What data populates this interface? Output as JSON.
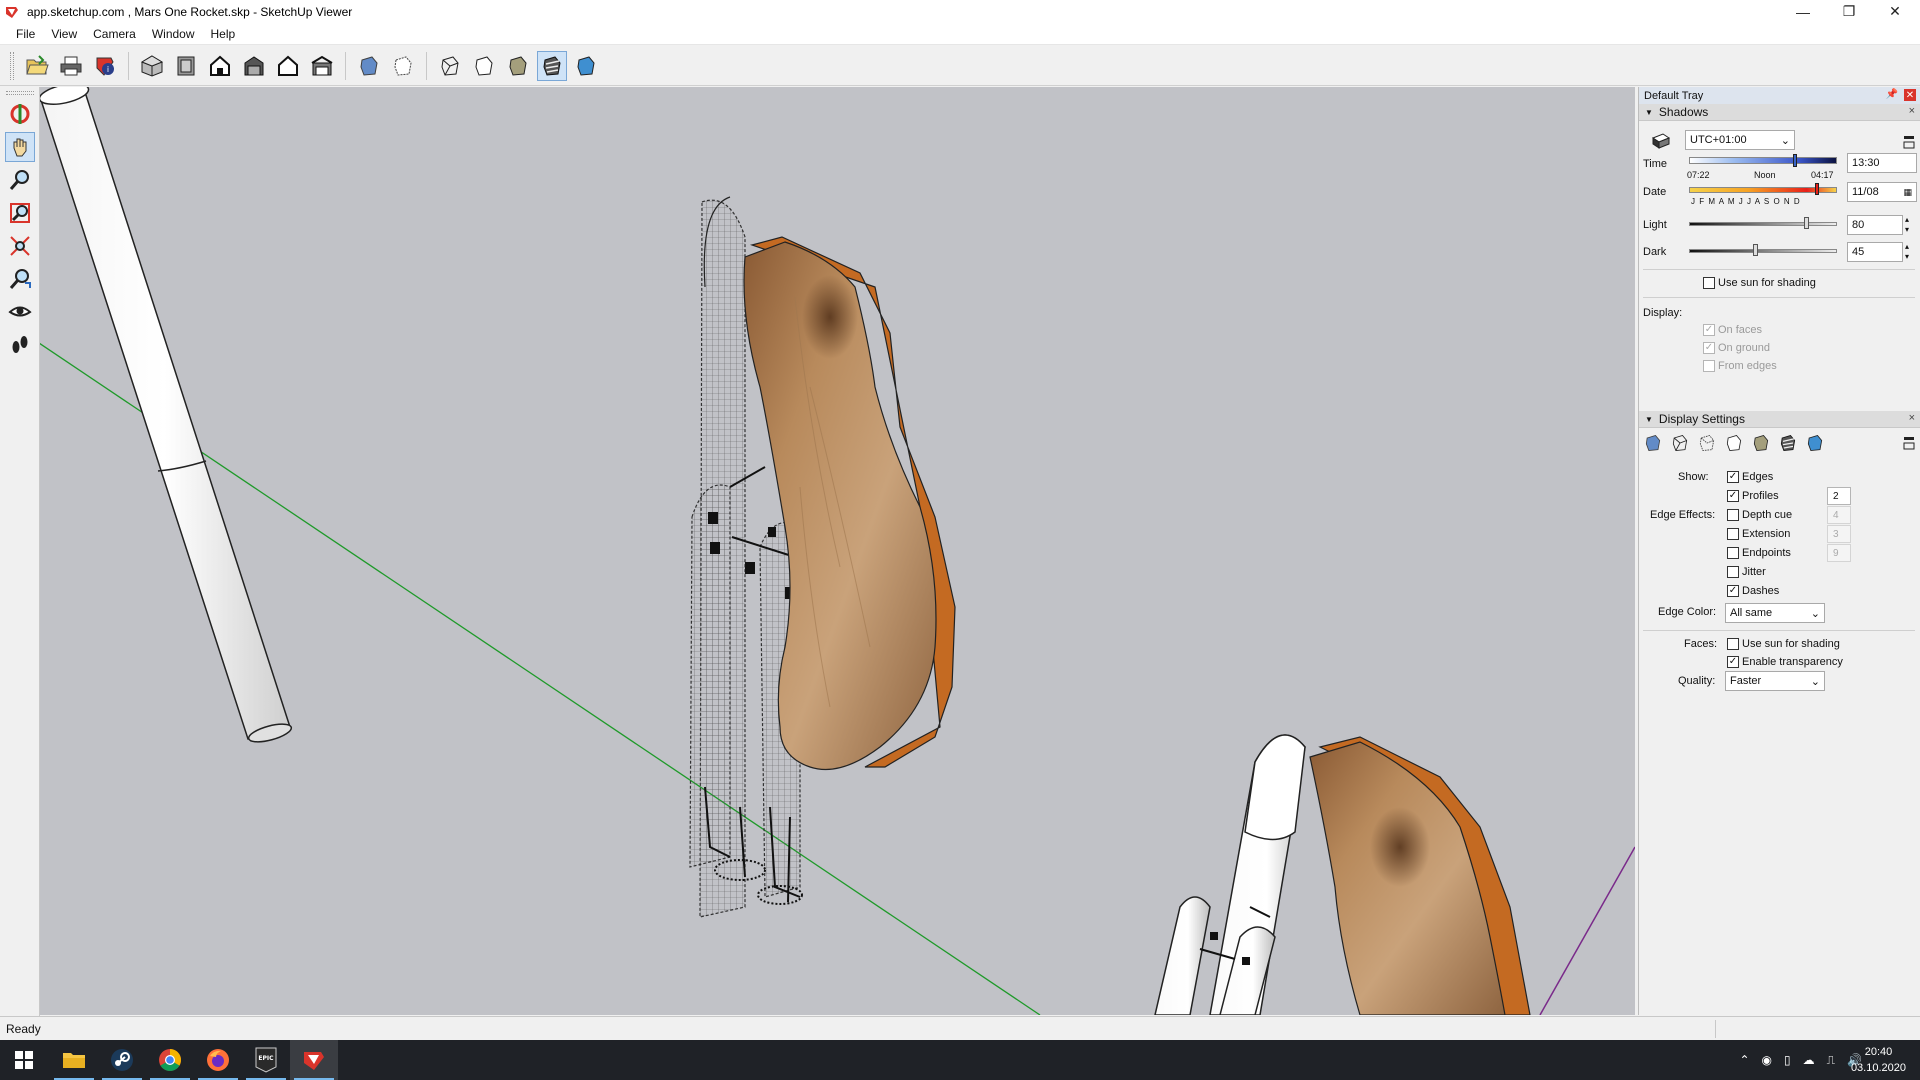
{
  "window": {
    "title": "app.sketchup.com , Mars One Rocket.skp - SketchUp Viewer",
    "minimize": "—",
    "maximize": "❐",
    "close": "✕"
  },
  "menu": [
    "File",
    "View",
    "Camera",
    "Window",
    "Help"
  ],
  "tray": {
    "title": "Default Tray",
    "shadows": {
      "header": "Shadows",
      "timezone": "UTC+01:00",
      "time_label": "Time",
      "time_start": "07:22",
      "time_noon": "Noon",
      "time_end": "04:17",
      "time_value": "13:30",
      "time_position": 0.72,
      "date_label": "Date",
      "months": "J F M A M J J A S O N D",
      "date_value": "11/08",
      "date_position": 0.88,
      "light_label": "Light",
      "light_value": "80",
      "dark_label": "Dark",
      "dark_value": "45",
      "use_sun": "Use sun for shading",
      "display_label": "Display:",
      "on_faces": "On faces",
      "on_ground": "On ground",
      "from_edges": "From edges"
    },
    "display_settings": {
      "header": "Display Settings",
      "show_label": "Show:",
      "edges": "Edges",
      "profiles": "Profiles",
      "profiles_value": "2",
      "edge_effects_label": "Edge Effects:",
      "depth_cue": "Depth cue",
      "depth_cue_value": "4",
      "extension": "Extension",
      "extension_value": "3",
      "endpoints": "Endpoints",
      "endpoints_value": "9",
      "jitter": "Jitter",
      "dashes": "Dashes",
      "edge_color_label": "Edge Color:",
      "edge_color_value": "All same",
      "faces_label": "Faces:",
      "faces_use_sun": "Use sun for shading",
      "enable_transparency": "Enable transparency",
      "quality_label": "Quality:",
      "quality_value": "Faster"
    }
  },
  "status": "Ready",
  "clock": {
    "time": "20:40",
    "date": "03.10.2020"
  },
  "colors": {
    "viewport": "#c1c2c7",
    "axis_green": "#1f9a2a",
    "axis_purple": "#7a2a8a",
    "taskbar": "#1f2227"
  }
}
